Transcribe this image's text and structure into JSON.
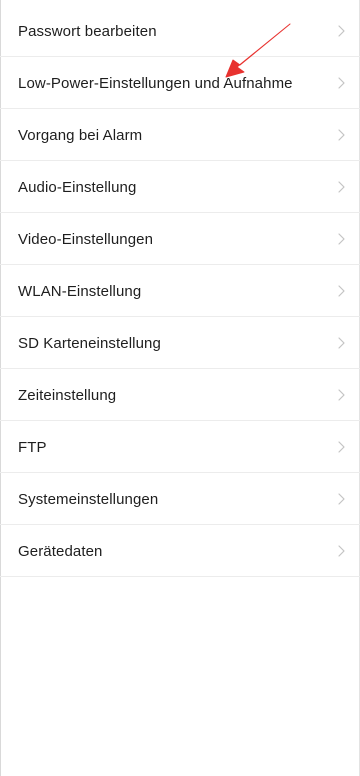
{
  "settings": {
    "items": [
      {
        "label": "Passwort bearbeiten",
        "icon": "chevron-right-icon"
      },
      {
        "label": "Low-Power-Einstellungen und Aufnahme",
        "icon": "chevron-right-icon"
      },
      {
        "label": "Vorgang bei Alarm",
        "icon": "chevron-right-icon"
      },
      {
        "label": "Audio-Einstellung",
        "icon": "chevron-right-icon"
      },
      {
        "label": "Video-Einstellungen",
        "icon": "chevron-right-icon"
      },
      {
        "label": "WLAN-Einstellung",
        "icon": "chevron-right-icon"
      },
      {
        "label": "SD Karteneinstellung",
        "icon": "chevron-right-icon"
      },
      {
        "label": "Zeiteinstellung",
        "icon": "chevron-right-icon"
      },
      {
        "label": "FTP",
        "icon": "chevron-right-icon"
      },
      {
        "label": "Systemeinstellungen",
        "icon": "chevron-right-icon"
      },
      {
        "label": "Gerätedaten",
        "icon": "chevron-right-icon"
      }
    ]
  },
  "annotation": {
    "color": "#e8322f",
    "points_to": "Low-Power-Einstellungen und Aufnahme"
  },
  "colors": {
    "text": "#1e1e1e",
    "separator": "#ececec",
    "chevron": "#c4c4c4",
    "background": "#ffffff"
  }
}
